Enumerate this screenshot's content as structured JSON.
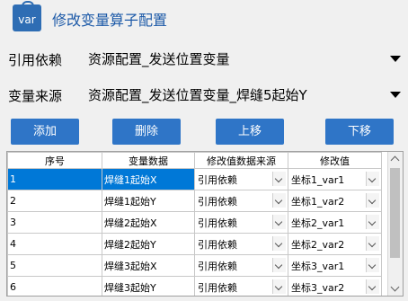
{
  "window": {
    "title": "修改变量算子配置",
    "icon_text": "var",
    "icon_name": "var-bag-icon"
  },
  "ref_source": {
    "label": "引用依赖",
    "value": "资源配置_发送位置变量"
  },
  "var_source": {
    "label": "变量来源",
    "value": "资源配置_发送位置变量_焊缝5起始Y"
  },
  "buttons": {
    "add": "添加",
    "delete": "删除",
    "up": "上移",
    "down": "下移"
  },
  "table": {
    "headers": [
      "序号",
      "变量数据",
      "修改值数据来源",
      "修改值"
    ],
    "rows": [
      {
        "no": "1",
        "var": "焊缝1起始X",
        "source": "引用依赖",
        "value": "坐标1_var1"
      },
      {
        "no": "2",
        "var": "焊缝1起始Y",
        "source": "引用依赖",
        "value": "坐标1_var2"
      },
      {
        "no": "3",
        "var": "焊缝2起始X",
        "source": "引用依赖",
        "value": "坐标2_var1"
      },
      {
        "no": "4",
        "var": "焊缝2起始Y",
        "source": "引用依赖",
        "value": "坐标2_var2"
      },
      {
        "no": "5",
        "var": "焊缝3起始X",
        "source": "引用依赖",
        "value": "坐标3_var1"
      },
      {
        "no": "6",
        "var": "焊缝3起始Y",
        "source": "引用依赖",
        "value": "坐标3_var2"
      }
    ]
  },
  "colors": {
    "accent": "#2f75c7",
    "selection": "#0078d7",
    "title": "#1d5aa8"
  }
}
